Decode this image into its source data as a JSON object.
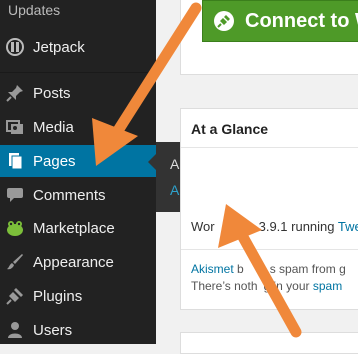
{
  "sidebar": {
    "updates_label": "Updates",
    "items": [
      {
        "label": "Jetpack",
        "icon": "jetpack-icon"
      },
      {
        "label": "Posts",
        "icon": "pushpin-icon"
      },
      {
        "label": "Media",
        "icon": "media-icon"
      },
      {
        "label": "Pages",
        "icon": "pages-icon",
        "active": true
      },
      {
        "label": "Comments",
        "icon": "comment-icon"
      },
      {
        "label": "Marketplace",
        "icon": "frog-icon"
      },
      {
        "label": "Appearance",
        "icon": "paintbrush-icon"
      },
      {
        "label": "Plugins",
        "icon": "plugin-icon"
      },
      {
        "label": "Users",
        "icon": "user-icon"
      }
    ],
    "active_color": "#0074a2"
  },
  "flyout": {
    "all_pages": "All Pages",
    "add_new": "Add New"
  },
  "main": {
    "connect_button": "Connect to W",
    "connect_color": "#4e9a28",
    "glance_title": "At a Glance",
    "wp_prefix": "Wor",
    "wp_version_text": "3.9.1 running",
    "wp_theme": "Twe",
    "akismet_link": "Akismet",
    "akismet_text": "b",
    "akismet_suffix": "s spam from g",
    "akismet_line2_prefix": "There’s noth",
    "akismet_line2_mid": "g in your",
    "akismet_line2_link": "spam"
  },
  "annotation": {
    "arrow_color": "#f0883a"
  }
}
